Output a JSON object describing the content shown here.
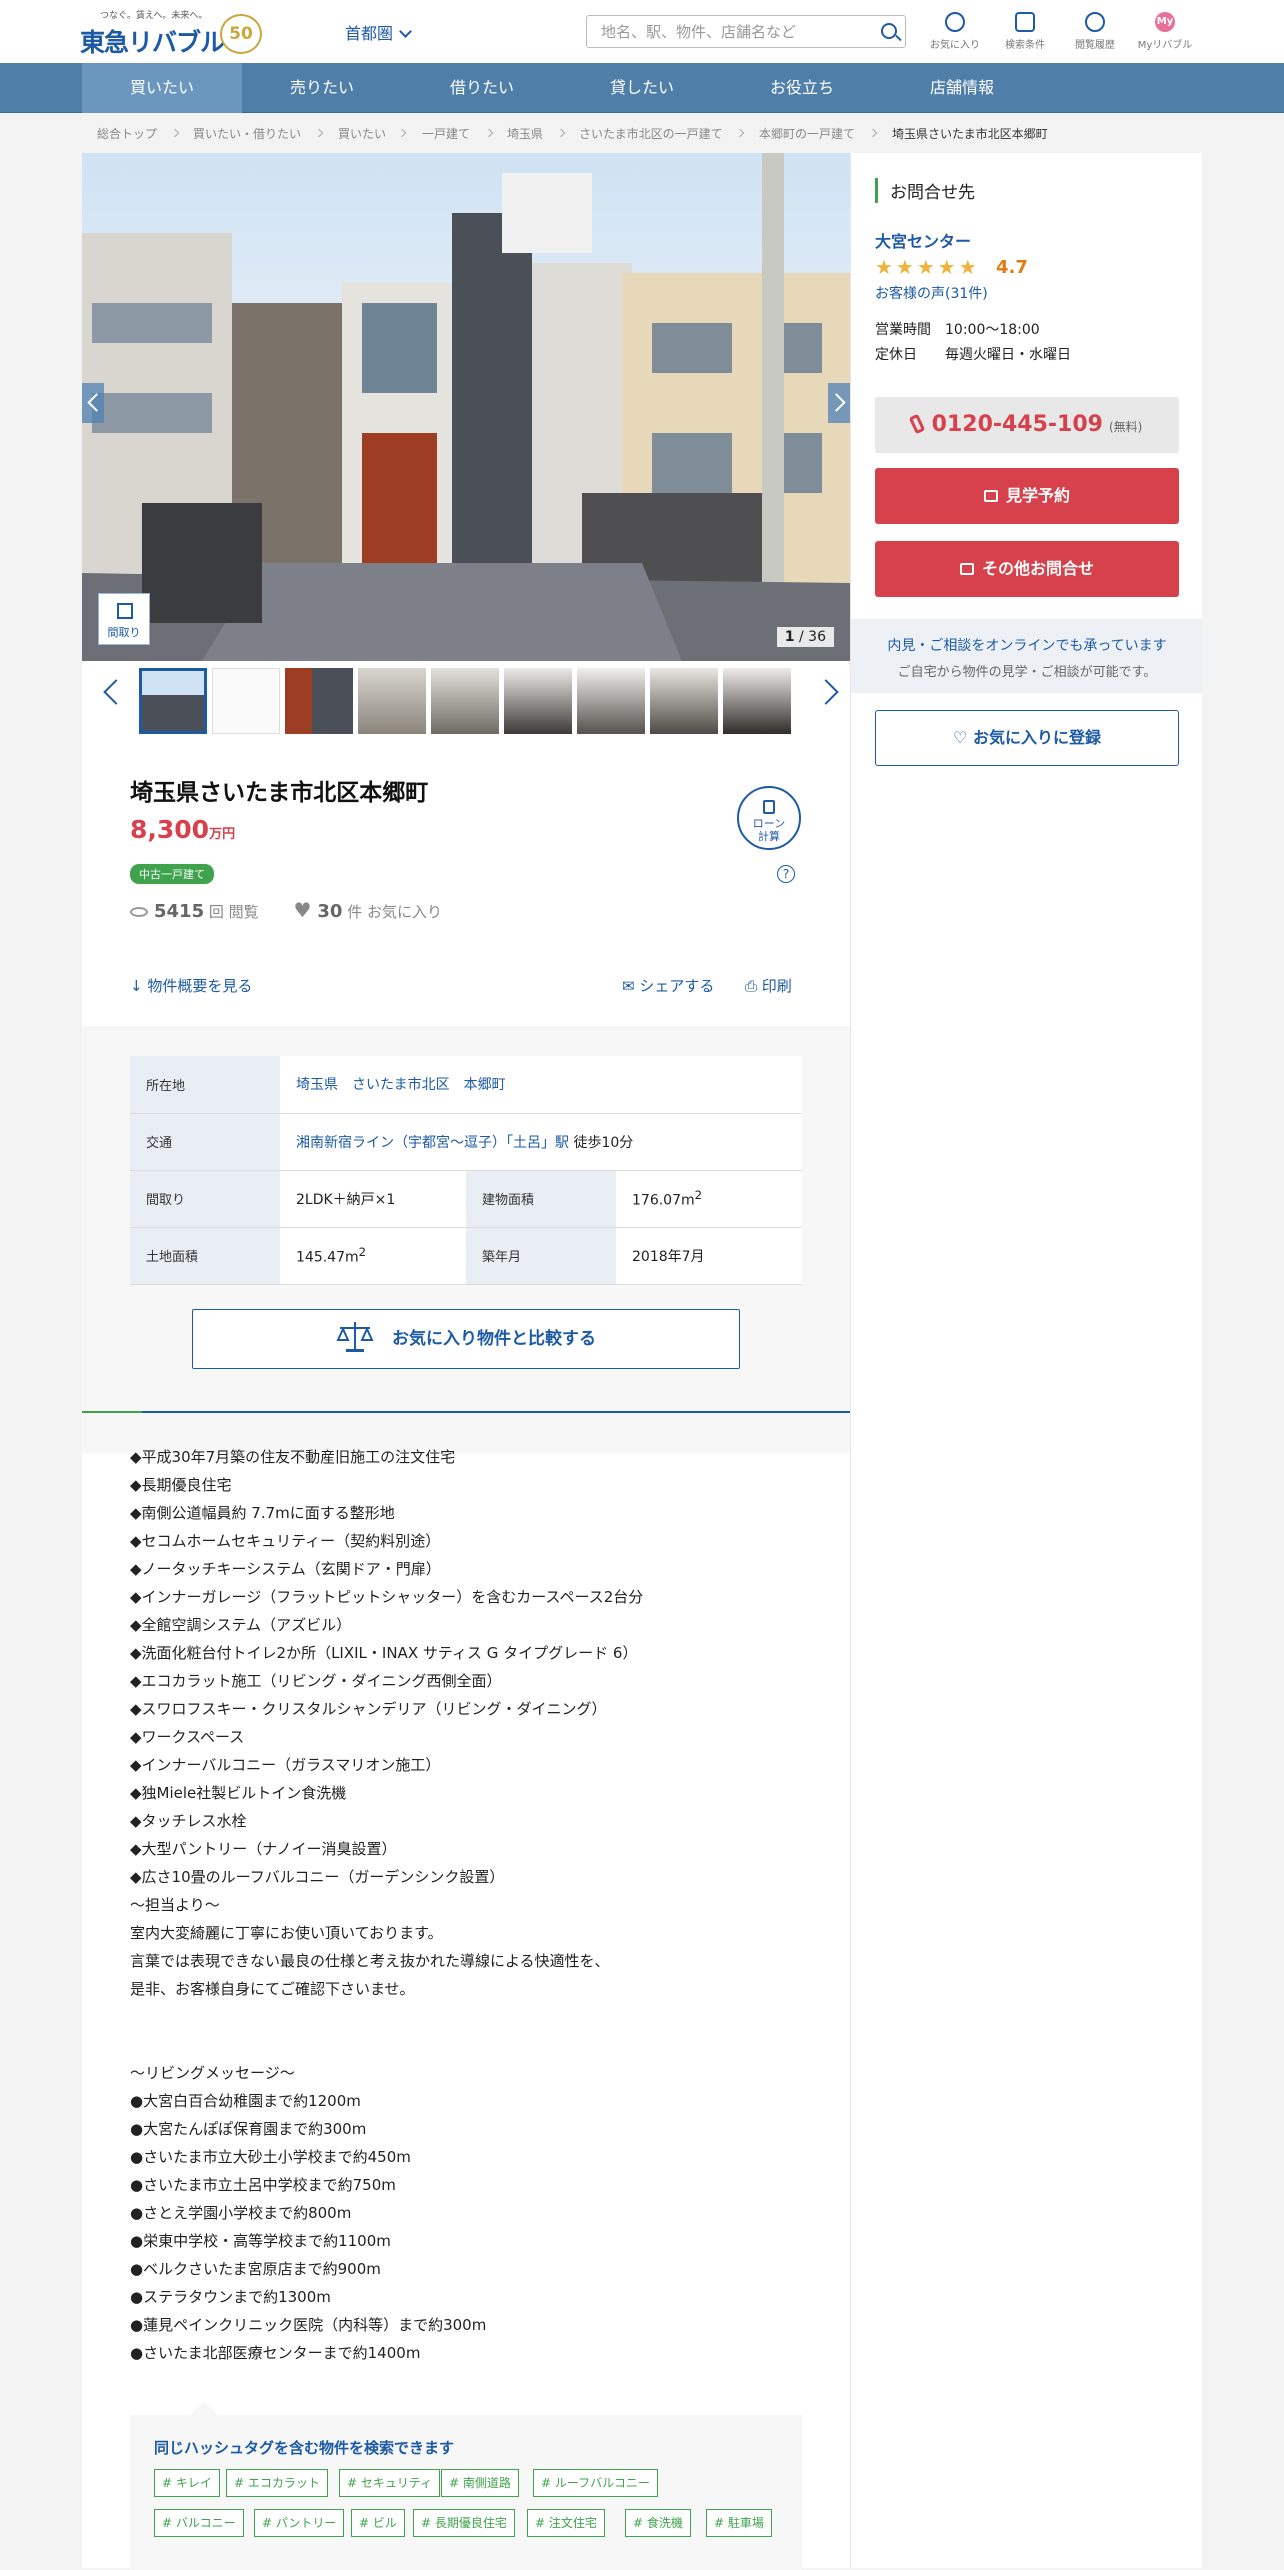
{
  "header": {
    "logo_tagline": "つなぐ。賃えへ。未来へ。",
    "logo_name": "東急リバブル",
    "logo_badge": "50",
    "region": "首都圏",
    "search_placeholder": "地名、駅、物件、店舗名など",
    "icons": [
      {
        "name": "favorite-icon",
        "label": "お気に入り"
      },
      {
        "name": "search-condition-icon",
        "label": "検索条件"
      },
      {
        "name": "history-icon",
        "label": "閲覧履歴"
      },
      {
        "name": "my-livable-icon",
        "label": "Myリバブル"
      }
    ]
  },
  "nav": [
    "買いたい",
    "売りたい",
    "借りたい",
    "貸したい",
    "お役立ち",
    "店舗情報"
  ],
  "breadcrumb": [
    "総合トップ",
    "買いたい・借りたい",
    "買いたい",
    "一戸建て",
    "埼玉県",
    "さいたま市北区の一戸建て",
    "本郷町の一戸建て",
    "埼玉県さいたま市北区本郷町"
  ],
  "gallery": {
    "floor_label": "間取り",
    "current": "1",
    "total": "36"
  },
  "property": {
    "title": "埼玉県さいたま市北区本郷町",
    "price": "8,300",
    "price_unit": "万円",
    "type_tag": "中古一戸建て",
    "loan_label_1": "ローン",
    "loan_label_2": "計算",
    "views": "5415",
    "views_unit": "回 閲覧",
    "favorites": "30",
    "favorites_unit": "件 お気に入り",
    "outline_link": "物件概要を見る",
    "share": "シェアする",
    "print": "印刷"
  },
  "spec": {
    "address_label": "所在地",
    "address": "埼玉県　さいたま市北区　本郷町",
    "traffic_label": "交通",
    "traffic_line": "湘南新宿ライン（宇都宮～逗子）「土呂」駅",
    "traffic_walk": "徒歩10分",
    "layout_label": "間取り",
    "layout": "2LDK＋納戸×1",
    "building_area_label": "建物面積",
    "building_area": "176.07m",
    "land_area_label": "土地面積",
    "land_area": "145.47m",
    "built_label": "築年月",
    "built": "2018年7月",
    "compare_button": "お気に入り物件と比較する"
  },
  "description": "◆平成30年7月築の住友不動産旧施工の注文住宅\n◆長期優良住宅\n◆南側公道幅員約 7.7mに面する整形地\n◆セコムホームセキュリティー（契約料別途）\n◆ノータッチキーシステム（玄関ドア・門扉）\n◆インナーガレージ（フラットピットシャッター）を含むカースペース2台分\n◆全館空調システム（アズビル）\n◆洗面化粧台付トイレ2か所（LIXIL・INAX サティス G タイプグレード 6）\n◆エコカラット施工（リビング・ダイニング西側全面）\n◆スワロフスキー・クリスタルシャンデリア（リビング・ダイニング）\n◆ワークスペース\n◆インナーバルコニー（ガラスマリオン施工）\n◆独Miele社製ビルトイン食洗機\n◆タッチレス水栓\n◆大型パントリー（ナノイー消臭設置）\n◆広さ10畳のルーフバルコニー（ガーデンシンク設置）\n～担当より～\n室内大変綺麗に丁寧にお使い頂いております。\n言葉では表現できない最良の仕様と考え抜かれた導線による快適性を、\n是非、お客様自身にてご確認下さいませ。\n\n\n～リビングメッセージ～\n●大宮白百合幼稚園まで約1200m\n●大宮たんぽぽ保育園まで約300m\n●さいたま市立大砂土小学校まで約450m\n●さいたま市立土呂中学校まで約750m\n●さとえ学園小学校まで約800m\n●栄東中学校・高等学校まで約1100m\n●ベルクさいたま宮原店まで約900m\n●ステラタウンまで約1300m\n●蓮見ペインクリニック医院（内科等）まで約300m\n●さいたま北部医療センターまで約1400m",
  "hashtags": {
    "heading": "同じハッシュタグを含む物件を検索できます",
    "tags": [
      "# キレイ",
      "# エコカラット",
      "# セキュリティ",
      "# 南側道路",
      "# ルーフバルコニー",
      "# バルコニー",
      "# パントリー",
      "# ビル",
      "# 長期優良住宅",
      "# 注文住宅",
      "# 食洗機",
      "# 駐車場"
    ]
  },
  "sidebar": {
    "heading": "お問合せ先",
    "shop": "大宮センター",
    "stars": "★★★★★",
    "rating": "4.7",
    "voice": "お客様の声(31件)",
    "hours_label": "営業時間",
    "hours": "10:00～18:00",
    "holiday_label": "定休日",
    "holiday": "毎週火曜日・水曜日",
    "tel": "0120-445-109",
    "tel_note": "(無料)",
    "visit_button": "見学予約",
    "other_button": "その他お問合せ",
    "online_1": "内見・ご相談をオンラインでも承っています",
    "online_2": "ご自宅から物件の見学・ご相談が可能です。",
    "fav_button": "お気に入りに登録"
  }
}
